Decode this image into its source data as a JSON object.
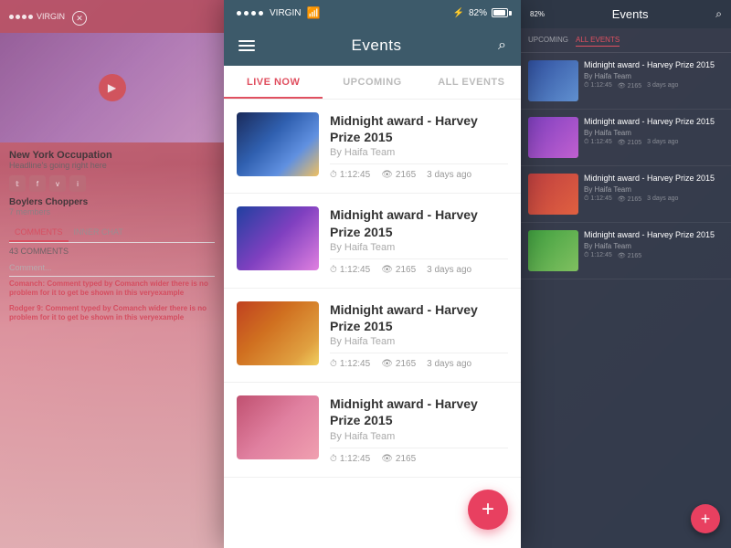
{
  "statusBar": {
    "carrier": "VIRGIN",
    "wifi": "wifi",
    "bluetooth": "bluetooth",
    "battery": "82%"
  },
  "header": {
    "title": "Events",
    "menuIcon": "menu",
    "searchIcon": "search"
  },
  "tabs": [
    {
      "id": "live",
      "label": "LIVE NOW",
      "active": true
    },
    {
      "id": "upcoming",
      "label": "UPCOMING",
      "active": false
    },
    {
      "id": "all",
      "label": "ALL EVENTS",
      "active": false
    }
  ],
  "events": [
    {
      "id": 1,
      "title": "Midnight award - Harvey Prize 2015",
      "author": "By Haifa Team",
      "duration": "1:12:45",
      "views": "2165",
      "timeAgo": "3 days ago",
      "thumbClass": "e1"
    },
    {
      "id": 2,
      "title": "Midnight award - Harvey Prize 2015",
      "author": "By Haifa Team",
      "duration": "1:12:45",
      "views": "2165",
      "timeAgo": "3 days ago",
      "thumbClass": "e2"
    },
    {
      "id": 3,
      "title": "Midnight award - Harvey Prize 2015",
      "author": "By Haifa Team",
      "duration": "1:12:45",
      "views": "2165",
      "timeAgo": "3 days ago",
      "thumbClass": "e3"
    },
    {
      "id": 4,
      "title": "Midnight award - Harvey Prize 2015",
      "author": "By Haifa Team",
      "duration": "1:12:45",
      "views": "2165",
      "timeAgo": "",
      "thumbClass": "e4"
    }
  ],
  "leftPanel": {
    "title": "New York Occupation",
    "subtitle": "Headline's going right here",
    "groupName": "Boylers Choppers",
    "members": "7 members",
    "tabs": [
      "COMMENTS",
      "INNER CHAT"
    ],
    "activeTab": "COMMENTS",
    "commentsCount": "43 COMMENTS",
    "commentPlaceholder": "Comment...",
    "comments": [
      {
        "author": "Comanch:",
        "text": "Comment typed by Comanch wider there is no problem for it to get be shown in this veryexample"
      },
      {
        "author": "Rodger 9:",
        "text": "Comment typed by Comanch wider there is no problem for it to get be shown in this veryexample"
      }
    ]
  },
  "rightPanel": {
    "title": "Events",
    "tabs": [
      "UPCOMING",
      "ALL EVENTS"
    ],
    "items": [
      {
        "title": "Midnight award - Harvey Prize 2015",
        "author": "By Haifa Team",
        "duration": "1:12:45",
        "views": "2165",
        "timeAgo": "3 days ago",
        "thumbClass": "t1"
      },
      {
        "title": "Midnight award - Harvey Prize 2015",
        "author": "By Haifa Team",
        "duration": "1:12:45",
        "views": "2105",
        "timeAgo": "3 days ago",
        "thumbClass": "t2"
      },
      {
        "title": "Midnight award - Harvey Prize 2015",
        "author": "By Haifa Team",
        "duration": "1:12:45",
        "views": "2165",
        "timeAgo": "3 days ago",
        "thumbClass": "t3"
      },
      {
        "title": "Midnight award - Harvey Prize 2015",
        "author": "By Haifa Team",
        "duration": "1:12:45",
        "views": "2165",
        "timeAgo": "",
        "thumbClass": "t4"
      }
    ]
  },
  "fab": {
    "label": "+"
  }
}
